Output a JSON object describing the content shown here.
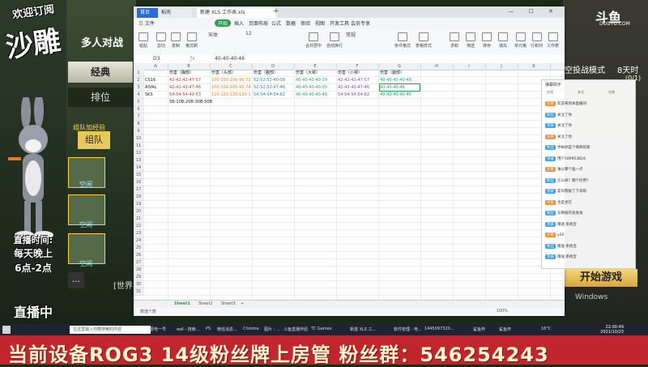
{
  "overlay": {
    "subscribe": "欢迎订阅",
    "name": "沙雕",
    "schedule_title": "直播时间:",
    "schedule_days": "每天晚上",
    "schedule_hours": "6点-2点",
    "live": "直播中"
  },
  "game": {
    "mode": "多人对战",
    "tab_classic": "经典",
    "tab_ranked": "排位",
    "team_tag": "组队加经验",
    "team_button": "组队",
    "slots": [
      "空闲",
      "空闲",
      "空闲"
    ],
    "world": "[世界",
    "douyu_logo": "斗鱼",
    "douyu_sub": "DOUYU.COM",
    "sky_mode": "空投战模式",
    "sky_room": "8天时",
    "page_counter": "(0/1)",
    "start_button": "开始游戏",
    "windows_watermark": "Windows"
  },
  "excel": {
    "tabs": {
      "home": "首页",
      "shell": "稻壳",
      "file": "新建 XLS 工作表.xls"
    },
    "menu": [
      "三 文件",
      "开始",
      "插入",
      "页面布局",
      "公式",
      "数据",
      "审阅",
      "视图",
      "开发工具",
      "会员专享"
    ],
    "ribbon": [
      "粘贴",
      "剪切",
      "复制",
      "格式刷",
      "宋体",
      "12",
      "合并居中",
      "自动换行",
      "常规",
      "条件格式",
      "表格样式",
      "求和",
      "筛选",
      "排序",
      "填充",
      "单元格",
      "行和列",
      "工作表"
    ],
    "cell_ref": "D3",
    "formula": "40-40-40-46",
    "columns": [
      "A",
      "B",
      "C",
      "D",
      "E",
      "F",
      "G",
      "H",
      "I",
      "J",
      "K",
      "L"
    ],
    "headers": [
      "伤害（胸部）",
      "伤害（头部）",
      "伤害（腹部）",
      "伤害（大臂）",
      "伤害（小臂）",
      "伤害（腿部）"
    ],
    "rows": [
      {
        "name": "CS16",
        "cells": [
          "42-42-42-47-57",
          "100-100-100-90-72",
          "52-52-52-40-38",
          "40-40-40-40-39",
          "42-42-42-47-57",
          "40-40-40-40-48"
        ]
      },
      {
        "name": "AIVAL",
        "cells": [
          "42-42-42-47-46",
          "100-100-100-90-74",
          "52-52-52-47-46",
          "40-40-40-40-35",
          "42-42-42-47-46",
          "40-40-40-46"
        ]
      },
      {
        "name": "SKS",
        "cells": [
          "54-54-54-40-53",
          "120-120-120-120-135",
          "54-54-54-54-62",
          "40-40-40-40-46",
          "54-54-54-54-62",
          "40-40-40-40-46"
        ]
      }
    ],
    "note_row": "5B-10B-20B-30B-50B",
    "sheets": [
      "Sheet1",
      "Sheet2",
      "Sheet3"
    ],
    "zoom": "100%",
    "status_left": "数值个数"
  },
  "chat": {
    "title": "弹幕助手",
    "stats": [
      "在线",
      "关注",
      "礼物"
    ],
    "messages": [
      "欢迎来到本直播间",
      "关注了你",
      "关注了你",
      "关注了你",
      "手帐你是个啊啊玩家",
      "用户189953824:",
      "谁以哪个猛一点",
      "怎么样？哪个好用?",
      "是叫我拔了下去呢",
      "也是坐在",
      "东朝坡的发发发",
      "赠送 系统宝",
      "x20",
      "赠送 系统宝",
      "赠送 系统宝"
    ],
    "badges": [
      "房管",
      "粉丝",
      "贵族"
    ]
  },
  "taskbar": {
    "search": "在这里输入你要搜索的内容",
    "items": [
      "雷电一号",
      "wdl - 搜索...",
      "PS",
      "微信消息...",
      "Chrome",
      "图片 - ...",
      "斗鱼直播伴侣",
      "TC Games",
      "新建 XLS 工...",
      "软件管理 - 电...",
      "1445097320...",
      "鲨鱼杯",
      "鲨鱼杯"
    ],
    "temp": "16°C",
    "time": "22:00:49",
    "date": "2021/10/23"
  },
  "banner": {
    "text": "当前设备ROG3 14级粉丝牌上房管 粉丝群：546254243"
  },
  "colors": {
    "banner_red": "#c1262e",
    "wps_green": "#2d9b4f",
    "tab_blue": "#2d6ad6"
  }
}
